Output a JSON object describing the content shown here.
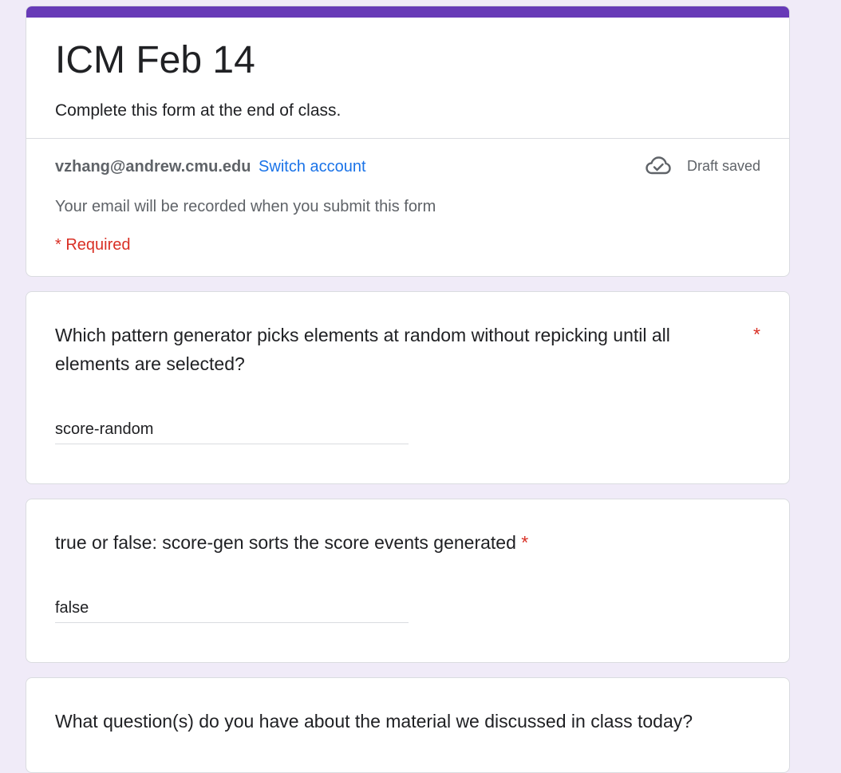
{
  "form": {
    "title": "ICM Feb 14",
    "description": "Complete this form at the end of class.",
    "account_email": "vzhang@andrew.cmu.edu",
    "switch_account_label": "Switch account",
    "draft_status": "Draft saved",
    "email_note": "Your email will be recorded when you submit this form",
    "required_note": "* Required"
  },
  "questions": [
    {
      "title": "Which pattern generator picks elements at random without repicking until all elements are selected?",
      "required_mark": "*",
      "answer": "score-random"
    },
    {
      "title": "true or false: score-gen sorts the score events generated",
      "required_mark": "*",
      "answer": "false"
    },
    {
      "title": "What question(s) do you have about the material we discussed in class today?"
    }
  ],
  "colors": {
    "accent": "#673ab7",
    "background": "#f0ebf8",
    "link": "#1a73e8",
    "required": "#d93025"
  },
  "icons": {
    "draft": "cloud-check-icon"
  }
}
